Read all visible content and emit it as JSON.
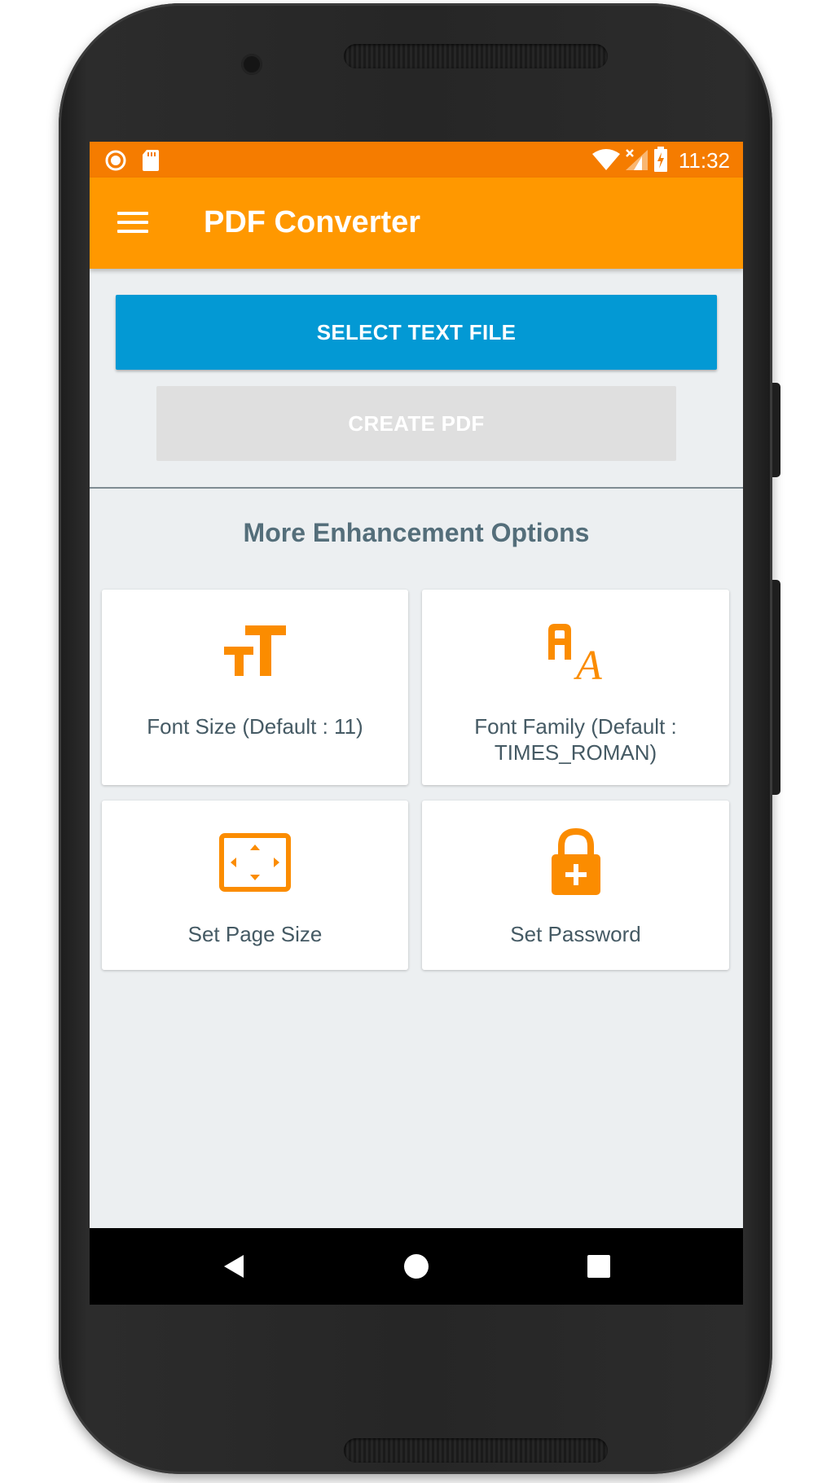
{
  "status_bar": {
    "time": "11:32"
  },
  "app_bar": {
    "title": "PDF Converter"
  },
  "actions": {
    "select_text_file": "SELECT TEXT FILE",
    "create_pdf": "CREATE PDF"
  },
  "options": {
    "title": "More Enhancement Options",
    "cards": [
      {
        "label": "Font Size (Default : 11)",
        "icon": "font-size-icon"
      },
      {
        "label_line1": "Font Family (Default :",
        "label_line2": "TIMES_ROMAN)",
        "icon": "font-family-icon"
      },
      {
        "label": "Set Page Size",
        "icon": "page-size-icon"
      },
      {
        "label": "Set Password",
        "icon": "lock-icon"
      }
    ]
  },
  "colors": {
    "status_bar": "#f57c00",
    "app_bar": "#ff9800",
    "primary_button": "#0399d4",
    "disabled_button": "#dfdfdf",
    "accent_icon": "#fb8c00",
    "section_title": "#546e7a"
  }
}
